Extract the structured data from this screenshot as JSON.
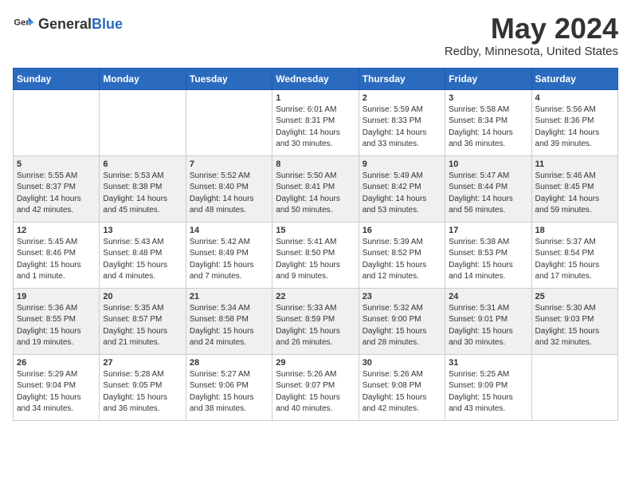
{
  "header": {
    "logo_general": "General",
    "logo_blue": "Blue",
    "month": "May 2024",
    "location": "Redby, Minnesota, United States"
  },
  "days_of_week": [
    "Sunday",
    "Monday",
    "Tuesday",
    "Wednesday",
    "Thursday",
    "Friday",
    "Saturday"
  ],
  "weeks": [
    [
      {
        "day": "",
        "text": ""
      },
      {
        "day": "",
        "text": ""
      },
      {
        "day": "",
        "text": ""
      },
      {
        "day": "1",
        "text": "Sunrise: 6:01 AM\nSunset: 8:31 PM\nDaylight: 14 hours\nand 30 minutes."
      },
      {
        "day": "2",
        "text": "Sunrise: 5:59 AM\nSunset: 8:33 PM\nDaylight: 14 hours\nand 33 minutes."
      },
      {
        "day": "3",
        "text": "Sunrise: 5:58 AM\nSunset: 8:34 PM\nDaylight: 14 hours\nand 36 minutes."
      },
      {
        "day": "4",
        "text": "Sunrise: 5:56 AM\nSunset: 8:36 PM\nDaylight: 14 hours\nand 39 minutes."
      }
    ],
    [
      {
        "day": "5",
        "text": "Sunrise: 5:55 AM\nSunset: 8:37 PM\nDaylight: 14 hours\nand 42 minutes."
      },
      {
        "day": "6",
        "text": "Sunrise: 5:53 AM\nSunset: 8:38 PM\nDaylight: 14 hours\nand 45 minutes."
      },
      {
        "day": "7",
        "text": "Sunrise: 5:52 AM\nSunset: 8:40 PM\nDaylight: 14 hours\nand 48 minutes."
      },
      {
        "day": "8",
        "text": "Sunrise: 5:50 AM\nSunset: 8:41 PM\nDaylight: 14 hours\nand 50 minutes."
      },
      {
        "day": "9",
        "text": "Sunrise: 5:49 AM\nSunset: 8:42 PM\nDaylight: 14 hours\nand 53 minutes."
      },
      {
        "day": "10",
        "text": "Sunrise: 5:47 AM\nSunset: 8:44 PM\nDaylight: 14 hours\nand 56 minutes."
      },
      {
        "day": "11",
        "text": "Sunrise: 5:46 AM\nSunset: 8:45 PM\nDaylight: 14 hours\nand 59 minutes."
      }
    ],
    [
      {
        "day": "12",
        "text": "Sunrise: 5:45 AM\nSunset: 8:46 PM\nDaylight: 15 hours\nand 1 minute."
      },
      {
        "day": "13",
        "text": "Sunrise: 5:43 AM\nSunset: 8:48 PM\nDaylight: 15 hours\nand 4 minutes."
      },
      {
        "day": "14",
        "text": "Sunrise: 5:42 AM\nSunset: 8:49 PM\nDaylight: 15 hours\nand 7 minutes."
      },
      {
        "day": "15",
        "text": "Sunrise: 5:41 AM\nSunset: 8:50 PM\nDaylight: 15 hours\nand 9 minutes."
      },
      {
        "day": "16",
        "text": "Sunrise: 5:39 AM\nSunset: 8:52 PM\nDaylight: 15 hours\nand 12 minutes."
      },
      {
        "day": "17",
        "text": "Sunrise: 5:38 AM\nSunset: 8:53 PM\nDaylight: 15 hours\nand 14 minutes."
      },
      {
        "day": "18",
        "text": "Sunrise: 5:37 AM\nSunset: 8:54 PM\nDaylight: 15 hours\nand 17 minutes."
      }
    ],
    [
      {
        "day": "19",
        "text": "Sunrise: 5:36 AM\nSunset: 8:55 PM\nDaylight: 15 hours\nand 19 minutes."
      },
      {
        "day": "20",
        "text": "Sunrise: 5:35 AM\nSunset: 8:57 PM\nDaylight: 15 hours\nand 21 minutes."
      },
      {
        "day": "21",
        "text": "Sunrise: 5:34 AM\nSunset: 8:58 PM\nDaylight: 15 hours\nand 24 minutes."
      },
      {
        "day": "22",
        "text": "Sunrise: 5:33 AM\nSunset: 8:59 PM\nDaylight: 15 hours\nand 26 minutes."
      },
      {
        "day": "23",
        "text": "Sunrise: 5:32 AM\nSunset: 9:00 PM\nDaylight: 15 hours\nand 28 minutes."
      },
      {
        "day": "24",
        "text": "Sunrise: 5:31 AM\nSunset: 9:01 PM\nDaylight: 15 hours\nand 30 minutes."
      },
      {
        "day": "25",
        "text": "Sunrise: 5:30 AM\nSunset: 9:03 PM\nDaylight: 15 hours\nand 32 minutes."
      }
    ],
    [
      {
        "day": "26",
        "text": "Sunrise: 5:29 AM\nSunset: 9:04 PM\nDaylight: 15 hours\nand 34 minutes."
      },
      {
        "day": "27",
        "text": "Sunrise: 5:28 AM\nSunset: 9:05 PM\nDaylight: 15 hours\nand 36 minutes."
      },
      {
        "day": "28",
        "text": "Sunrise: 5:27 AM\nSunset: 9:06 PM\nDaylight: 15 hours\nand 38 minutes."
      },
      {
        "day": "29",
        "text": "Sunrise: 5:26 AM\nSunset: 9:07 PM\nDaylight: 15 hours\nand 40 minutes."
      },
      {
        "day": "30",
        "text": "Sunrise: 5:26 AM\nSunset: 9:08 PM\nDaylight: 15 hours\nand 42 minutes."
      },
      {
        "day": "31",
        "text": "Sunrise: 5:25 AM\nSunset: 9:09 PM\nDaylight: 15 hours\nand 43 minutes."
      },
      {
        "day": "",
        "text": ""
      }
    ]
  ]
}
